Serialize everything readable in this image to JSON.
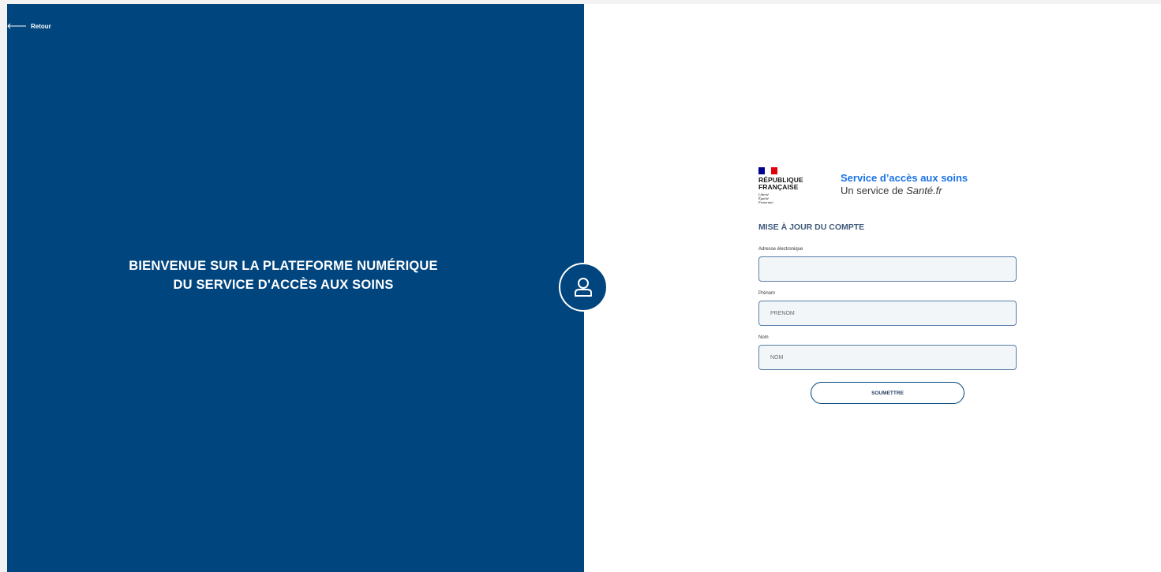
{
  "nav": {
    "back_label": "Retour"
  },
  "hero": {
    "welcome_text": "BIENVENUE SUR LA PLATEFORME NUMÉRIQUE DU SERVICE D'ACCÈS AUX SOINS",
    "avatar_icon": "user-icon"
  },
  "brand": {
    "republic_line1": "RÉPUBLIQUE",
    "republic_line2": "FRANÇAISE",
    "motto_line1": "Liberté",
    "motto_line2": "Égalité",
    "motto_line3": "Fraternité",
    "service_title": "Service d’accès aux soins",
    "service_sub_prefix": "Un service de ",
    "service_sub_brand": "Santé.fr"
  },
  "form": {
    "heading": "MISE À JOUR DU COMPTE",
    "email_label": "Adresse électronique",
    "email_value": "",
    "firstname_label": "Prénom",
    "firstname_placeholder": "PRENOM",
    "lastname_label": "Nom",
    "lastname_placeholder": "NOM",
    "submit_label": "SOUMETTRE"
  },
  "colors": {
    "primary_blue": "#00457e",
    "accent_blue": "#1a73e8",
    "flag_blue": "#000091",
    "flag_red": "#e1000f"
  }
}
